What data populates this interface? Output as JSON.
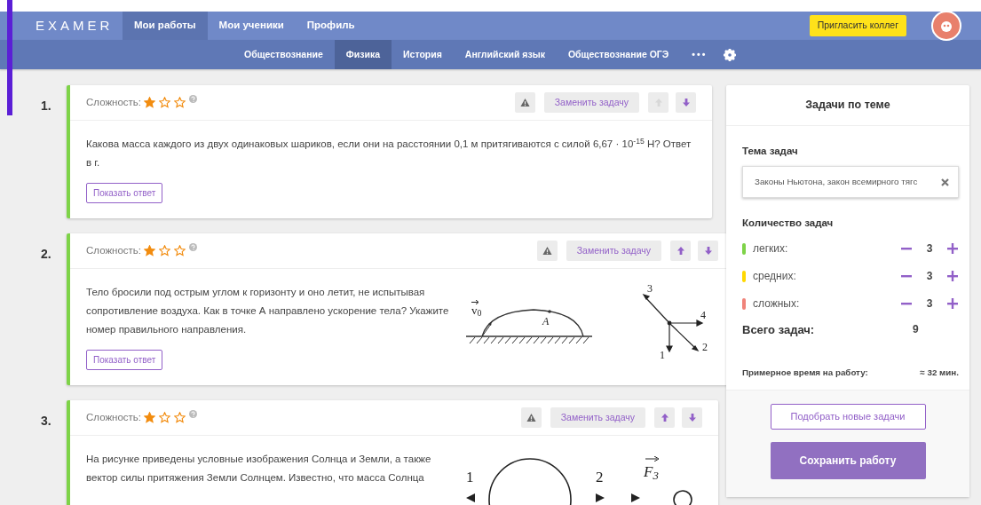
{
  "header": {
    "logo": "EXAMER",
    "nav": [
      {
        "label": "Мои работы",
        "selected": true
      },
      {
        "label": "Мои ученики",
        "selected": false
      },
      {
        "label": "Профиль",
        "selected": false
      }
    ],
    "invite_button": "Пригласить коллег"
  },
  "subjects": {
    "items": [
      {
        "label": "Обществознание",
        "selected": false
      },
      {
        "label": "Физика",
        "selected": true
      },
      {
        "label": "История",
        "selected": false
      },
      {
        "label": "Английский язык",
        "selected": false
      },
      {
        "label": "Обществознание ОГЭ",
        "selected": false
      }
    ],
    "more": "•••"
  },
  "tasks": [
    {
      "number": "1.",
      "difficulty_label": "Сложность:",
      "stars": 1,
      "up_disabled": true,
      "down_disabled": false,
      "replace_button": "Заменить задачу",
      "text": "Какова масса каждого из двух одинаковых шариков, если они на расстоянии 0,1 м притягиваются с силой 6,67 · 10$^{-15}$ Н? Ответ в г.",
      "answer_button": "Показать ответ"
    },
    {
      "number": "2.",
      "difficulty_label": "Сложность:",
      "stars": 1,
      "up_disabled": false,
      "down_disabled": false,
      "replace_button": "Заменить задачу",
      "text": "Тело бросили под острым углом к горизонту и оно летит, не испытывая сопротивление воздуха. Как в точке А направлено ускорение тела? Укажите номер правильного направления.",
      "figures": [
        {
          "kind": "trajectory",
          "labels": [
            "v$_{0}$",
            "A"
          ]
        },
        {
          "kind": "vectors",
          "labels": [
            "3",
            "4",
            "1",
            "2"
          ]
        }
      ],
      "answer_button": "Показать ответ"
    },
    {
      "number": "3.",
      "difficulty_label": "Сложность:",
      "stars": 1,
      "up_disabled": false,
      "down_disabled": false,
      "replace_button": "Заменить задачу",
      "text": "На рисунке приведены условные изображения Солнца и Земли, а также вектор силы притяжения Земли Солнцем. Известно, что масса Солнца",
      "figures": [
        {
          "kind": "sun_earth",
          "labels": [
            "1",
            "2",
            "F$_{3}$"
          ]
        }
      ]
    }
  ],
  "sidebar": {
    "title": "Задачи по теме",
    "topic_label": "Тема задач",
    "topic_value": "Законы Ньютона, закон всемирного тягс",
    "count_label": "Количество задач",
    "levels": [
      {
        "label": "легких:",
        "color": "#7ed348",
        "value": "3"
      },
      {
        "label": "средних:",
        "color": "#ffd800",
        "value": "3"
      },
      {
        "label": "сложных:",
        "color": "#f0837a",
        "value": "3"
      }
    ],
    "total_label": "Всего задач:",
    "total_value": "9",
    "time_label": "Примерное время на работу:",
    "time_value": "≈ 32 мин.",
    "pick_button": "Подобрать новые задачи",
    "save_button": "Сохранить работу"
  }
}
